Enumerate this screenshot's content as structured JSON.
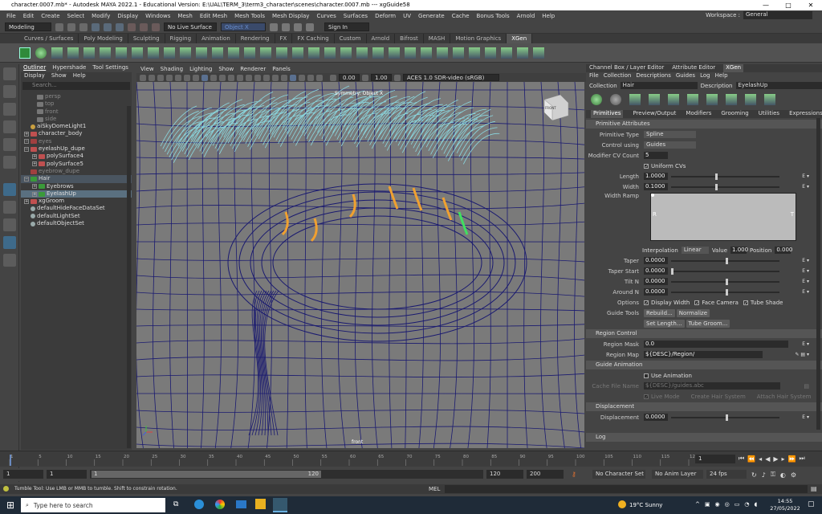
{
  "window": {
    "title": "character.0007.mb* - Autodesk MAYA 2022.1 - Educational Version: E:\\UAL\\TERM_3\\term3_character\\scenes\\character.0007.mb  ---  xgGuide58",
    "controls": [
      "—",
      "□",
      "✕"
    ]
  },
  "menubar": {
    "items": [
      "File",
      "Edit",
      "Create",
      "Select",
      "Modify",
      "Display",
      "Windows",
      "Mesh",
      "Edit Mesh",
      "Mesh Tools",
      "Mesh Display",
      "Curves",
      "Surfaces",
      "Deform",
      "UV",
      "Generate",
      "Cache",
      "Bonus Tools",
      "Arnold",
      "Help"
    ],
    "workspace_label": "Workspace :",
    "workspace_value": "General"
  },
  "statusline": {
    "mode": "Modeling",
    "live_surface": "No Live Surface",
    "object_field": "Object X",
    "sign_in": "Sign In"
  },
  "shelf": {
    "tabs": [
      "Curves / Surfaces",
      "Poly Modeling",
      "Sculpting",
      "Rigging",
      "Animation",
      "Rendering",
      "FX",
      "FX Caching",
      "Custom",
      "Arnold",
      "Bifrost",
      "MASH",
      "Motion Graphics",
      "XGen"
    ],
    "active_tab": "XGen"
  },
  "outliner": {
    "tabs": [
      "Outliner",
      "Hypershade",
      "Tool Settings"
    ],
    "menu": [
      "Display",
      "Show",
      "Help"
    ],
    "search_placeholder": "Search...",
    "items": [
      {
        "label": "persp",
        "dim": true
      },
      {
        "label": "top",
        "dim": true
      },
      {
        "label": "front",
        "dim": true
      },
      {
        "label": "side",
        "dim": true
      },
      {
        "label": "aiSkyDomeLight1",
        "dim": false
      },
      {
        "label": "character_body",
        "dim": false
      },
      {
        "label": "eyes",
        "dim": true
      },
      {
        "label": "eyelashUp_dupe",
        "dim": false
      },
      {
        "label": "polySurface4",
        "dim": false
      },
      {
        "label": "polySurface5",
        "dim": false
      },
      {
        "label": "eyebrow_dupe",
        "dim": true
      },
      {
        "label": "Hair",
        "dim": false
      },
      {
        "label": "Eyebrows",
        "dim": false
      },
      {
        "label": "EyelashUp",
        "dim": false
      },
      {
        "label": "xgGroom",
        "dim": false
      },
      {
        "label": "defaultHideFaceDataSet",
        "dim": false
      },
      {
        "label": "defaultLightSet",
        "dim": false
      },
      {
        "label": "defaultObjectSet",
        "dim": false
      }
    ]
  },
  "viewport": {
    "menu": [
      "View",
      "Shading",
      "Lighting",
      "Show",
      "Renderer",
      "Panels"
    ],
    "exposure": "0.00",
    "gamma": "1.00",
    "color_space": "ACES 1.0 SDR-video (sRGB)",
    "symmetry_label": "Symmetry: Object X",
    "camera_label": "front",
    "viewcube_label": "FRONT",
    "guide_color": "#f0a030",
    "selected_guide_color": "#40e060",
    "hair_color": "#8ad8e0",
    "wire_color": "#1a1a70"
  },
  "rightpanel": {
    "tabs": [
      "Channel Box / Layer Editor",
      "Attribute Editor",
      "XGen"
    ],
    "active_tab": "XGen",
    "menu": [
      "File",
      "Collection",
      "Descriptions",
      "Guides",
      "Log",
      "Help"
    ],
    "collection_label": "Collection",
    "collection_value": "Hair",
    "description_label": "Description",
    "description_value": "EyelashUp",
    "subtabs": [
      "Primitives",
      "Preview/Output",
      "Modifiers",
      "Grooming",
      "Utilities",
      "Expressions"
    ],
    "active_subtab": "Primitives",
    "primitive_section": "Primitive Attributes",
    "primitive_type_label": "Primitive Type",
    "primitive_type": "Spline",
    "control_using_label": "Control using",
    "control_using": "Guides",
    "modifier_cv_label": "Modifier CV Count",
    "modifier_cv": "5",
    "uniform_cvs": "Uniform CVs",
    "length_label": "Length",
    "length": "1.0000",
    "width_label": "Width",
    "width": "0.1000",
    "width_ramp_label": "Width Ramp",
    "ramp_left": "R",
    "ramp_right": "T",
    "interp_label": "Interpolation",
    "interp_value": "Linear",
    "value_label": "Value",
    "value_value": "1.000",
    "position_label": "Position",
    "position_value": "0.000",
    "taper_label": "Taper",
    "taper": "0.0000",
    "taper_start_label": "Taper Start",
    "taper_start": "0.0000",
    "tilt_label": "Tilt N",
    "tilt": "0.0000",
    "around_label": "Around N",
    "around": "0.0000",
    "options_label": "Options",
    "opt_display_width": "Display Width",
    "opt_face_camera": "Face Camera",
    "opt_tube_shade": "Tube Shade",
    "guide_tools_label": "Guide Tools",
    "btn_rebuild": "Rebuild...",
    "btn_normalize": "Normalize",
    "btn_set_length": "Set Length...",
    "btn_tube_groom": "Tube Groom...",
    "region_section": "Region Control",
    "region_mask_label": "Region Mask",
    "region_mask": "0.0",
    "region_map_label": "Region Map",
    "region_map": "${DESC}/Region/",
    "guide_anim_section": "Guide Animation",
    "use_animation": "Use Animation",
    "cache_file_label": "Cache File Name",
    "cache_file": "${DESC}/guides.abc",
    "live_mode": "Live Mode",
    "create_hair_system": "Create Hair System",
    "attach_hair_system": "Attach Hair System",
    "displacement_section": "Displacement",
    "displacement_label": "Displacement",
    "displacement": "0.0000",
    "log_section": "Log"
  },
  "timeline": {
    "ticks": [
      "1",
      "5",
      "10",
      "15",
      "20",
      "25",
      "30",
      "35",
      "40",
      "45",
      "50",
      "55",
      "60",
      "65",
      "70",
      "75",
      "80",
      "85",
      "90",
      "95",
      "100",
      "105",
      "110",
      "115",
      "120"
    ],
    "current_frame": "1"
  },
  "rangebar": {
    "start": "1",
    "start2": "1",
    "range_inner_start": "1",
    "range_inner_end": "120",
    "end": "120",
    "end2": "200",
    "character_set": "No Character Set",
    "anim_layer": "No Anim Layer",
    "fps": "24 fps"
  },
  "cmdline": {
    "help": "Tumble Tool: Use LMB or MMB to tumble. Shift to constrain rotation.",
    "lang": "MEL"
  },
  "taskbar": {
    "search_placeholder": "Type here to search",
    "weather": "19°C  Sunny",
    "time": "14:55",
    "date": "27/05/2022"
  }
}
